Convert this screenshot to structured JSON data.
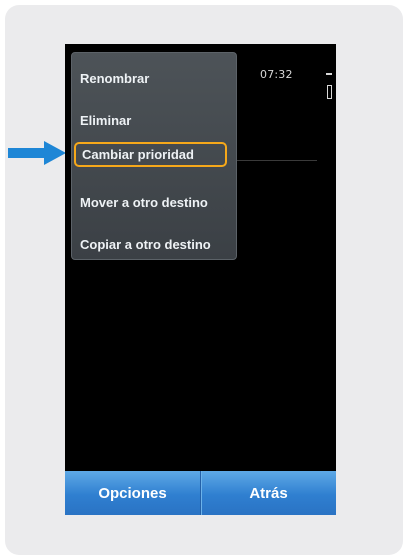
{
  "menu": {
    "items": [
      {
        "label": "Renombrar"
      },
      {
        "label": "Eliminar"
      },
      {
        "label": "Cambiar prioridad",
        "highlighted": true
      },
      {
        "label": "Mover a otro destino"
      },
      {
        "label": "Copiar a otro destino"
      }
    ]
  },
  "status": {
    "time": "07:32"
  },
  "softkeys": {
    "left": "Opciones",
    "right": "Atrás"
  },
  "colors": {
    "highlight_border": "#f6a81a",
    "arrow": "#1e86d6",
    "softkey_bar": "#2f7fd0"
  },
  "icons": {
    "pointer": "right-arrow-icon"
  }
}
